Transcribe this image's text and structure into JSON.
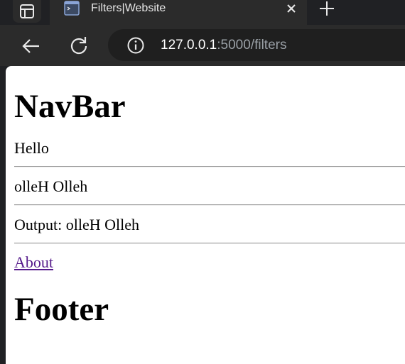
{
  "browser": {
    "tab": {
      "title": "Filters|Website"
    },
    "address_bar": {
      "host": "127.0.0.1",
      "rest": ":5000/filters"
    }
  },
  "page": {
    "heading": "NavBar",
    "lines": [
      "Hello",
      "olleH Olleh",
      "Output: olleH Olleh"
    ],
    "link": "About",
    "footer": "Footer"
  },
  "colors": {
    "link_visited": "#551a8b",
    "chrome_dark": "#202124",
    "chrome_toolbar": "#2b2b2b"
  }
}
